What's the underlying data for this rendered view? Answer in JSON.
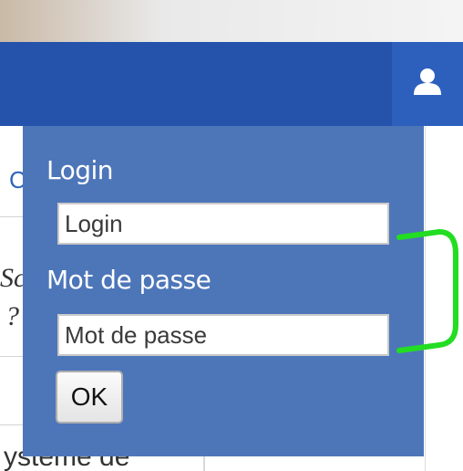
{
  "header": {
    "user_icon": "user-icon",
    "nav_color": "#2553ab"
  },
  "background_fragments": {
    "blue_letter": "C",
    "italic_line_1": "Sc",
    "italic_line_2": "?",
    "bottom_text": "ystème de"
  },
  "login_form": {
    "login_label": "Login",
    "login_placeholder": "Login",
    "password_label": "Mot de passe",
    "password_placeholder": "Mot de passe",
    "submit_label": "OK",
    "panel_color": "#4d76b9"
  },
  "annotation": {
    "bracket_color": "#22dd22"
  }
}
